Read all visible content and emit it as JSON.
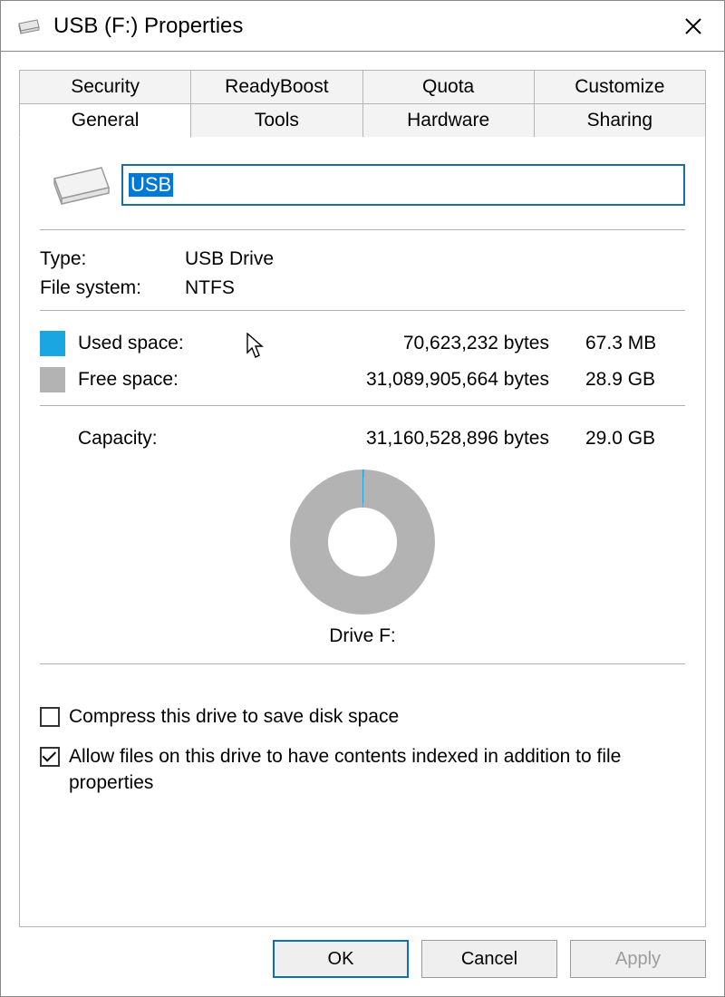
{
  "window": {
    "title": "USB (F:) Properties"
  },
  "tabs": {
    "row1": [
      "Security",
      "ReadyBoost",
      "Quota",
      "Customize"
    ],
    "row2": [
      "General",
      "Tools",
      "Hardware",
      "Sharing"
    ],
    "active": "General"
  },
  "general": {
    "volume_name": "USB",
    "type_label": "Type:",
    "type_value": "USB Drive",
    "fs_label": "File system:",
    "fs_value": "NTFS",
    "used_label": "Used space:",
    "used_bytes": "70,623,232 bytes",
    "used_hr": "67.3 MB",
    "free_label": "Free space:",
    "free_bytes": "31,089,905,664 bytes",
    "free_hr": "28.9 GB",
    "capacity_label": "Capacity:",
    "capacity_bytes": "31,160,528,896 bytes",
    "capacity_hr": "29.0 GB",
    "drive_caption": "Drive F:",
    "compress_label": "Compress this drive to save disk space",
    "compress_checked": false,
    "index_label": "Allow files on this drive to have contents indexed in addition to file properties",
    "index_checked": true
  },
  "buttons": {
    "ok": "OK",
    "cancel": "Cancel",
    "apply": "Apply"
  },
  "colors": {
    "used": "#1aa6e0",
    "free": "#b3b3b3",
    "accent_border": "#1a6fa0"
  },
  "chart_data": {
    "type": "pie",
    "title": "Drive F:",
    "series": [
      {
        "name": "Used space",
        "value_bytes": 70623232,
        "value_hr": "67.3 MB",
        "color": "#1aa6e0"
      },
      {
        "name": "Free space",
        "value_bytes": 31089905664,
        "value_hr": "28.9 GB",
        "color": "#b3b3b3"
      }
    ],
    "total_bytes": 31160528896,
    "total_hr": "29.0 GB"
  }
}
